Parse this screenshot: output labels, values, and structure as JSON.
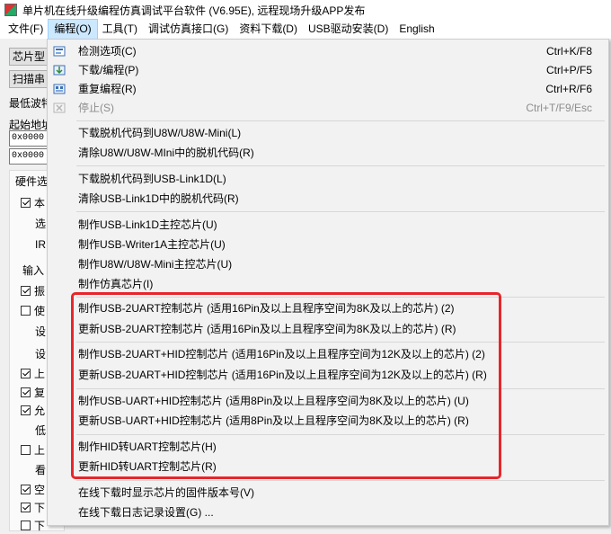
{
  "window": {
    "title": "单片机在线升级编程仿真调试平台软件 (V6.95E), 远程现场升级APP发布"
  },
  "menubar": {
    "items": [
      {
        "label": "文件(F)"
      },
      {
        "label": "编程(O)"
      },
      {
        "label": "工具(T)"
      },
      {
        "label": "调试仿真接口(G)"
      },
      {
        "label": "资料下载(D)"
      },
      {
        "label": "USB驱动安装(D)"
      },
      {
        "label": "English"
      }
    ]
  },
  "background": {
    "chip_btn": "芯片型",
    "scan_btn": "扫描串",
    "min_baud_label": "最低波特",
    "start_addr_label": "起始地址",
    "addr1": "0x0000",
    "addr2": "0x0000",
    "group_title": "硬件选",
    "rows": [
      "本",
      "选",
      "IR",
      "输入",
      "振",
      "使",
      "设",
      "设",
      "上",
      "复",
      "允",
      "低",
      "上",
      "看",
      "空",
      "下",
      "下"
    ]
  },
  "dropdown": {
    "items": [
      {
        "label": "检测选项(C)",
        "shortcut": "Ctrl+K/F8",
        "icon": "check-options-icon",
        "disabled": false
      },
      {
        "label": "下载/编程(P)",
        "shortcut": "Ctrl+P/F5",
        "icon": "download-program-icon",
        "disabled": false
      },
      {
        "label": "重复编程(R)",
        "shortcut": "Ctrl+R/F6",
        "icon": "repeat-program-icon",
        "disabled": false
      },
      {
        "label": "停止(S)",
        "shortcut": "Ctrl+T/F9/Esc",
        "icon": "stop-icon",
        "disabled": true
      },
      {
        "label": "下载脱机代码到U8W/U8W-Mini(L)"
      },
      {
        "label": "清除U8W/U8W-MIni中的脱机代码(R)"
      },
      {
        "label": "下载脱机代码到USB-Link1D(L)"
      },
      {
        "label": "清除USB-Link1D中的脱机代码(R)"
      },
      {
        "label": "制作USB-Link1D主控芯片(U)"
      },
      {
        "label": "制作USB-Writer1A主控芯片(U)"
      },
      {
        "label": "制作U8W/U8W-Mini主控芯片(U)"
      },
      {
        "label": "制作仿真芯片(I)"
      },
      {
        "label": "制作USB-2UART控制芯片 (适用16Pin及以上且程序空间为8K及以上的芯片) (2)"
      },
      {
        "label": "更新USB-2UART控制芯片 (适用16Pin及以上且程序空间为8K及以上的芯片) (R)"
      },
      {
        "label": "制作USB-2UART+HID控制芯片 (适用16Pin及以上且程序空间为12K及以上的芯片) (2)"
      },
      {
        "label": "更新USB-2UART+HID控制芯片 (适用16Pin及以上且程序空间为12K及以上的芯片) (R)"
      },
      {
        "label": "制作USB-UART+HID控制芯片 (适用8Pin及以上且程序空间为8K及以上的芯片) (U)"
      },
      {
        "label": "更新USB-UART+HID控制芯片 (适用8Pin及以上且程序空间为8K及以上的芯片) (R)"
      },
      {
        "label": "制作HID转UART控制芯片(H)"
      },
      {
        "label": "更新HID转UART控制芯片(R)"
      },
      {
        "label": "在线下载时显示芯片的固件版本号(V)"
      },
      {
        "label": "在线下载日志记录设置(G) ..."
      }
    ]
  },
  "colors": {
    "highlight_border": "#e8262a",
    "menu_active": "#cce8ff"
  }
}
